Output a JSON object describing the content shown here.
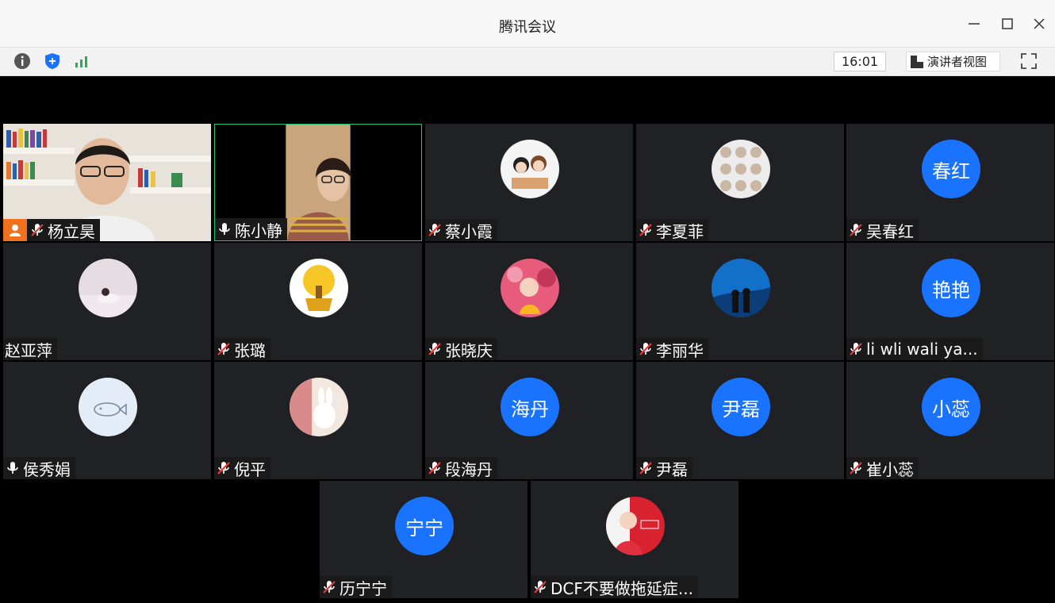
{
  "window": {
    "title": "腾讯会议"
  },
  "toolbar": {
    "time": "16:01",
    "presenter_view_label": "演讲者视图"
  },
  "participants": [
    {
      "name": "杨立昊",
      "avatar_text": "",
      "mic": "muted",
      "host": true
    },
    {
      "name": "陈小静",
      "avatar_text": "",
      "mic": "on",
      "speaking": true
    },
    {
      "name": "蔡小霞",
      "avatar_text": "",
      "mic": "muted"
    },
    {
      "name": "李夏菲",
      "avatar_text": "",
      "mic": "muted"
    },
    {
      "name": "吴春红",
      "avatar_text": "春红",
      "mic": "muted"
    },
    {
      "name": "赵亚萍",
      "avatar_text": "",
      "mic": "none"
    },
    {
      "name": "张璐",
      "avatar_text": "",
      "mic": "muted"
    },
    {
      "name": "张晓庆",
      "avatar_text": "",
      "mic": "muted"
    },
    {
      "name": "李丽华",
      "avatar_text": "",
      "mic": "muted"
    },
    {
      "name": "li wli wali ya...",
      "avatar_text": "艳艳",
      "mic": "muted"
    },
    {
      "name": "侯秀娟",
      "avatar_text": "",
      "mic": "on"
    },
    {
      "name": "倪平",
      "avatar_text": "",
      "mic": "muted"
    },
    {
      "name": "段海丹",
      "avatar_text": "海丹",
      "mic": "muted"
    },
    {
      "name": "尹磊",
      "avatar_text": "尹磊",
      "mic": "muted"
    },
    {
      "name": "崔小蕊",
      "avatar_text": "小蕊",
      "mic": "muted"
    },
    {
      "name": "历宁宁",
      "avatar_text": "宁宁",
      "mic": "muted"
    },
    {
      "name": "DCF不要做拖延症...",
      "avatar_text": "",
      "mic": "muted"
    }
  ],
  "colors": {
    "avatar_blue": "#1a73ff",
    "active_border": "#25c26b",
    "host_badge": "#f2711c",
    "tile_bg": "#202124"
  }
}
